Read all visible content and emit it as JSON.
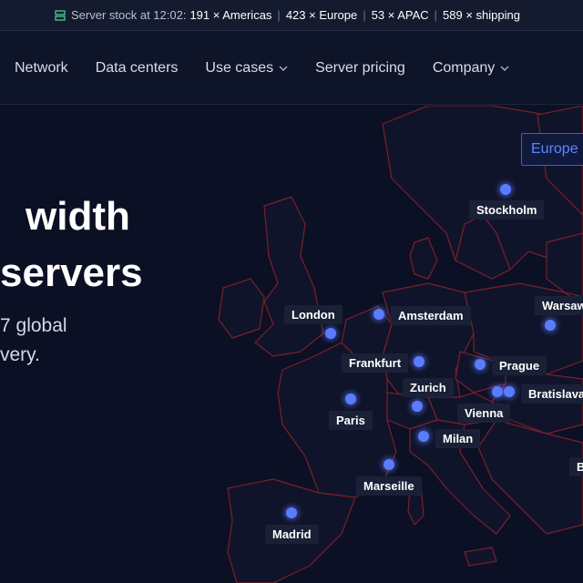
{
  "topbar": {
    "label": "Server stock at 12:02:",
    "items": [
      "191 × Americas",
      "423 × Europe",
      "53 × APAC",
      "589 × shipping"
    ],
    "separator": "|",
    "icon": "server-stack-icon",
    "accent_color": "#3ecf8e"
  },
  "nav": {
    "items": [
      {
        "label": "Network",
        "dropdown": false
      },
      {
        "label": "Data centers",
        "dropdown": false
      },
      {
        "label": "Use cases",
        "dropdown": true
      },
      {
        "label": "Server pricing",
        "dropdown": false
      },
      {
        "label": "Company",
        "dropdown": true
      }
    ]
  },
  "hero": {
    "headline_line1": "width",
    "headline_line2": "servers",
    "sub_line1": "7 global",
    "sub_line2": "very."
  },
  "region_button": {
    "label": "Europe",
    "color": "#5f85ff"
  },
  "map": {
    "border_color": "#7a1f2b",
    "dot_color": "#5a7cff",
    "cities": [
      "Stockholm",
      "London",
      "Amsterdam",
      "Warsaw",
      "Frankfurt",
      "Prague",
      "Zurich",
      "Bratislava",
      "Paris",
      "Vienna",
      "Milan",
      "Marseille",
      "Madrid",
      "B"
    ]
  }
}
